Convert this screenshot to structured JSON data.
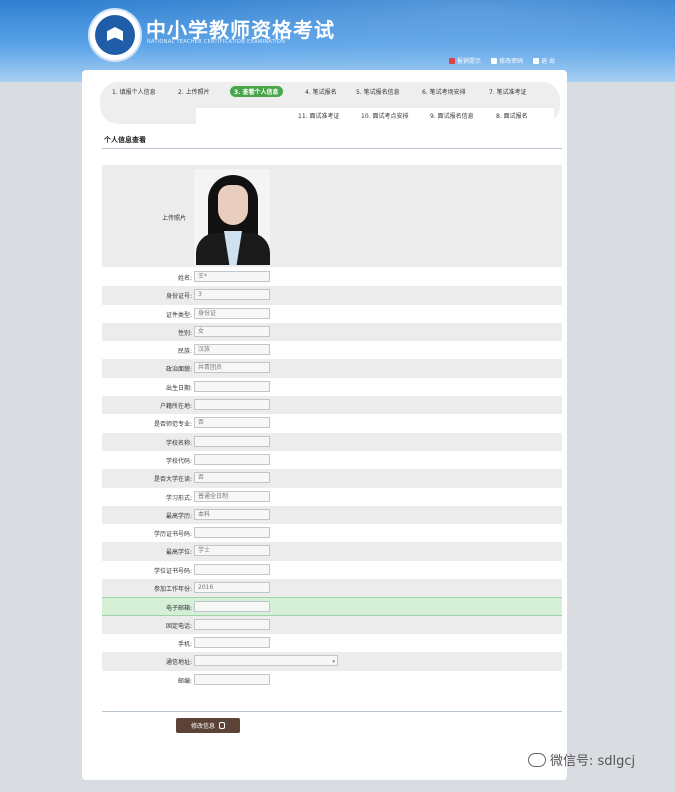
{
  "header": {
    "title": "中小学教师资格考试",
    "subtitle": "NATIONAL TEACHER CERTIFICATION EXAMINATION",
    "links": [
      "报销提示",
      "修改密码",
      "退 出"
    ]
  },
  "steps": {
    "row1": [
      "1. 填报个人信息",
      "2. 上传照片",
      "3. 查看个人信息",
      "4. 笔试报名",
      "5. 笔试报名信息",
      "6. 笔试考场安排",
      "7. 笔试准考证"
    ],
    "row2": [
      "11. 面试准考证",
      "10. 面试考点安排",
      "9. 面试报名信息",
      "8. 面试报名"
    ]
  },
  "section_title": "个人信息查看",
  "photo_label": "上传照片",
  "fields": [
    {
      "label": "姓名:",
      "value": "王*"
    },
    {
      "label": "身份证号:",
      "value": "3"
    },
    {
      "label": "证件类型:",
      "value": "身份证"
    },
    {
      "label": "性别:",
      "value": "女"
    },
    {
      "label": "民族:",
      "value": "汉族"
    },
    {
      "label": "政治面貌:",
      "value": "共青团员"
    },
    {
      "label": "出生日期:",
      "value": ""
    },
    {
      "label": "户籍所在地:",
      "value": ""
    },
    {
      "label": "是否师范专业:",
      "value": "否"
    },
    {
      "label": "学校名称:",
      "value": ""
    },
    {
      "label": "学校代码:",
      "value": ""
    },
    {
      "label": "是否大学在读:",
      "value": "否"
    },
    {
      "label": "学习形式:",
      "value": "普通全日制"
    },
    {
      "label": "最高学历:",
      "value": "本科"
    },
    {
      "label": "学历证书号码:",
      "value": ""
    },
    {
      "label": "最高学位:",
      "value": "学士"
    },
    {
      "label": "学位证书号码:",
      "value": ""
    },
    {
      "label": "参加工作年份:",
      "value": "2016"
    },
    {
      "label": "电子邮箱:",
      "value": ""
    },
    {
      "label": "固定电话:",
      "value": ""
    },
    {
      "label": "手机:",
      "value": ""
    },
    {
      "label": "通信地址:",
      "value": ""
    },
    {
      "label": "邮编:",
      "value": ""
    }
  ],
  "button_label": "修改信息",
  "watermark": "微信号: sdlgcj",
  "colors": {
    "active_step": "#4aa64a",
    "highlight_row": "#d6f0d8",
    "button": "#5b4338"
  }
}
